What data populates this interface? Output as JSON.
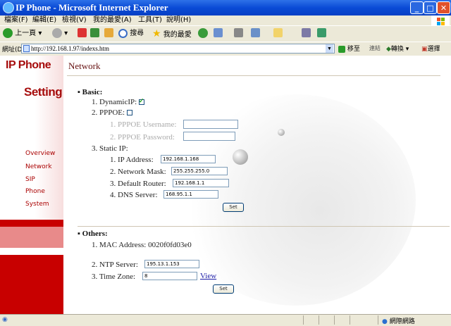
{
  "window": {
    "title": "IP Phone - Microsoft Internet Explorer",
    "min": "_",
    "max": "□",
    "close": "✕"
  },
  "menu": [
    "檔案(F)",
    "編輯(E)",
    "檢視(V)",
    "我的最愛(A)",
    "工具(T)",
    "說明(H)"
  ],
  "toolbar": {
    "back": "上一頁",
    "search": "搜尋",
    "favorites": "我的最愛"
  },
  "address": {
    "label": "網址(D)",
    "url": "http://192.168.1.97/indexs.htm",
    "go": "移至",
    "links": "連結",
    "convert": "轉換",
    "select": "選擇"
  },
  "sidebar": {
    "logo_line1": "IP Phone",
    "logo_line2": "Setting",
    "items": [
      "Overview",
      "Network",
      "SIP",
      "Phone",
      "System"
    ]
  },
  "page": {
    "title": "Network",
    "basic": {
      "heading": "Basic:",
      "dynamic_ip": {
        "num": "1.",
        "label": "DynamicIP:",
        "checked": true
      },
      "pppoe": {
        "num": "2.",
        "label": "PPPOE:",
        "checked": false
      },
      "pppoe_username": {
        "num": "1.",
        "label": "PPPOE Username:",
        "value": ""
      },
      "pppoe_password": {
        "num": "2.",
        "label": "PPPOE Password:",
        "value": ""
      },
      "static_ip": {
        "num": "3.",
        "label": "Static IP:"
      },
      "ip_address": {
        "num": "1.",
        "label": "IP Address:",
        "value": "192.168.1.168"
      },
      "network_mask": {
        "num": "2.",
        "label": "Network Mask:",
        "value": "255.255.255.0"
      },
      "default_router": {
        "num": "3.",
        "label": "Default Router:",
        "value": "192.168.1.1"
      },
      "dns_server": {
        "num": "4.",
        "label": "DNS Server:",
        "value": "168.95.1.1"
      },
      "set_button": "Set"
    },
    "others": {
      "heading": "Others:",
      "mac": {
        "num": "1.",
        "label": "MAC Address:",
        "value": "0020f0fd03e0"
      },
      "ntp": {
        "num": "2.",
        "label": "NTP Server:",
        "value": "195.13.1.153"
      },
      "tz": {
        "num": "3.",
        "label": "Time Zone:",
        "value": "8",
        "link": "View"
      },
      "set_button": "Set"
    }
  },
  "status": {
    "zone": "網際網路"
  },
  "colors": {
    "accent": "#a60c0c",
    "titlebar": "#0a4bd6"
  }
}
